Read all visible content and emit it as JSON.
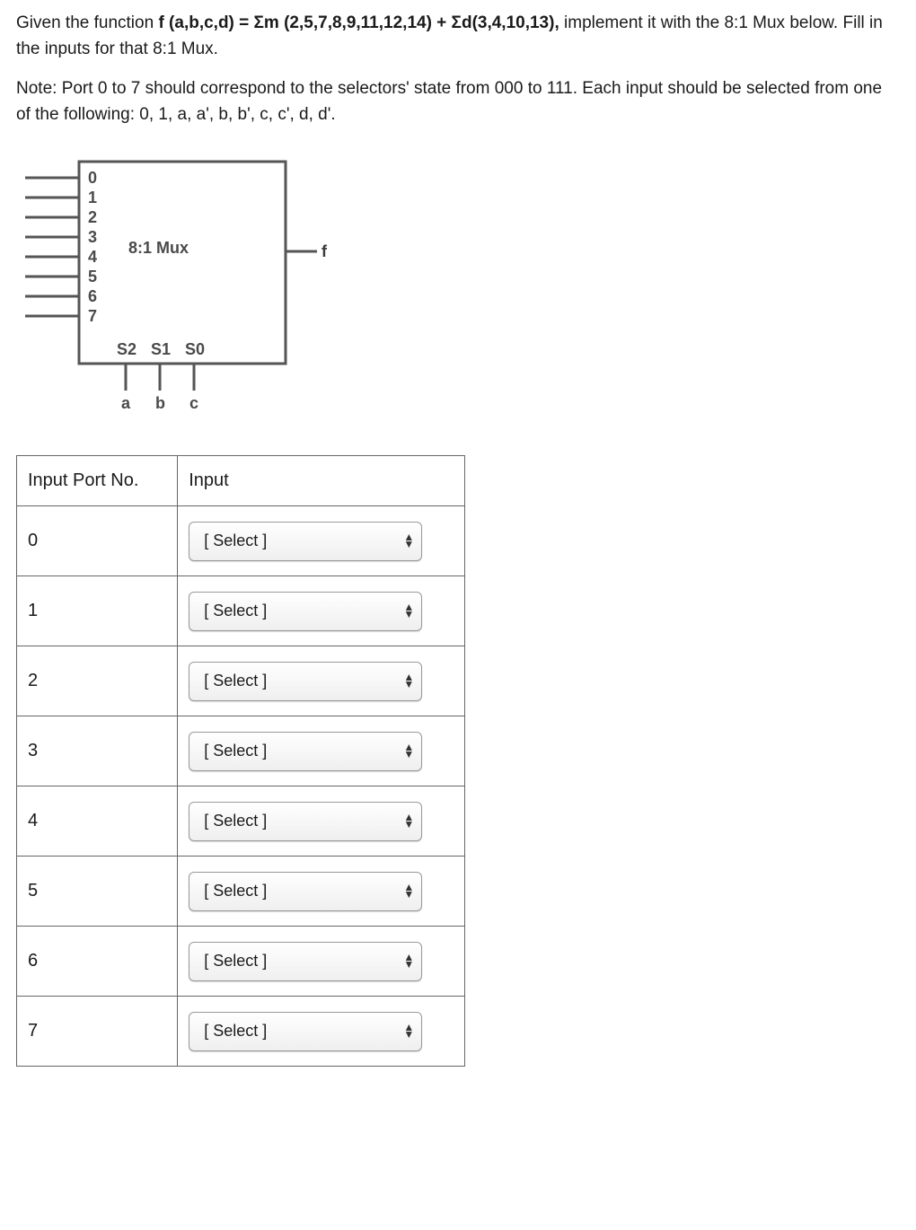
{
  "question": {
    "prefix": "Given the function ",
    "function_def": "f (a,b,c,d) = Σm (2,5,7,8,9,11,12,14) + Σd(3,4,10,13), ",
    "suffix": "implement it with the 8:1 Mux below. Fill in the inputs for that 8:1 Mux."
  },
  "note": "Note: Port 0 to 7 should correspond to the selectors' state from 000 to 111. Each input should be selected from one of the following: 0, 1, a, a', b, b', c, c', d, d'.",
  "mux": {
    "label": "8:1 Mux",
    "inputs": [
      "0",
      "1",
      "2",
      "3",
      "4",
      "5",
      "6",
      "7"
    ],
    "selectors_top": [
      "S2",
      "S1",
      "S0"
    ],
    "selectors_bottom": [
      "a",
      "b",
      "c"
    ],
    "output": "f"
  },
  "table": {
    "headers": {
      "port": "Input Port No.",
      "input": "Input"
    },
    "rows": [
      {
        "port": "0",
        "value": "[ Select ]"
      },
      {
        "port": "1",
        "value": "[ Select ]"
      },
      {
        "port": "2",
        "value": "[ Select ]"
      },
      {
        "port": "3",
        "value": "[ Select ]"
      },
      {
        "port": "4",
        "value": "[ Select ]"
      },
      {
        "port": "5",
        "value": "[ Select ]"
      },
      {
        "port": "6",
        "value": "[ Select ]"
      },
      {
        "port": "7",
        "value": "[ Select ]"
      }
    ]
  }
}
